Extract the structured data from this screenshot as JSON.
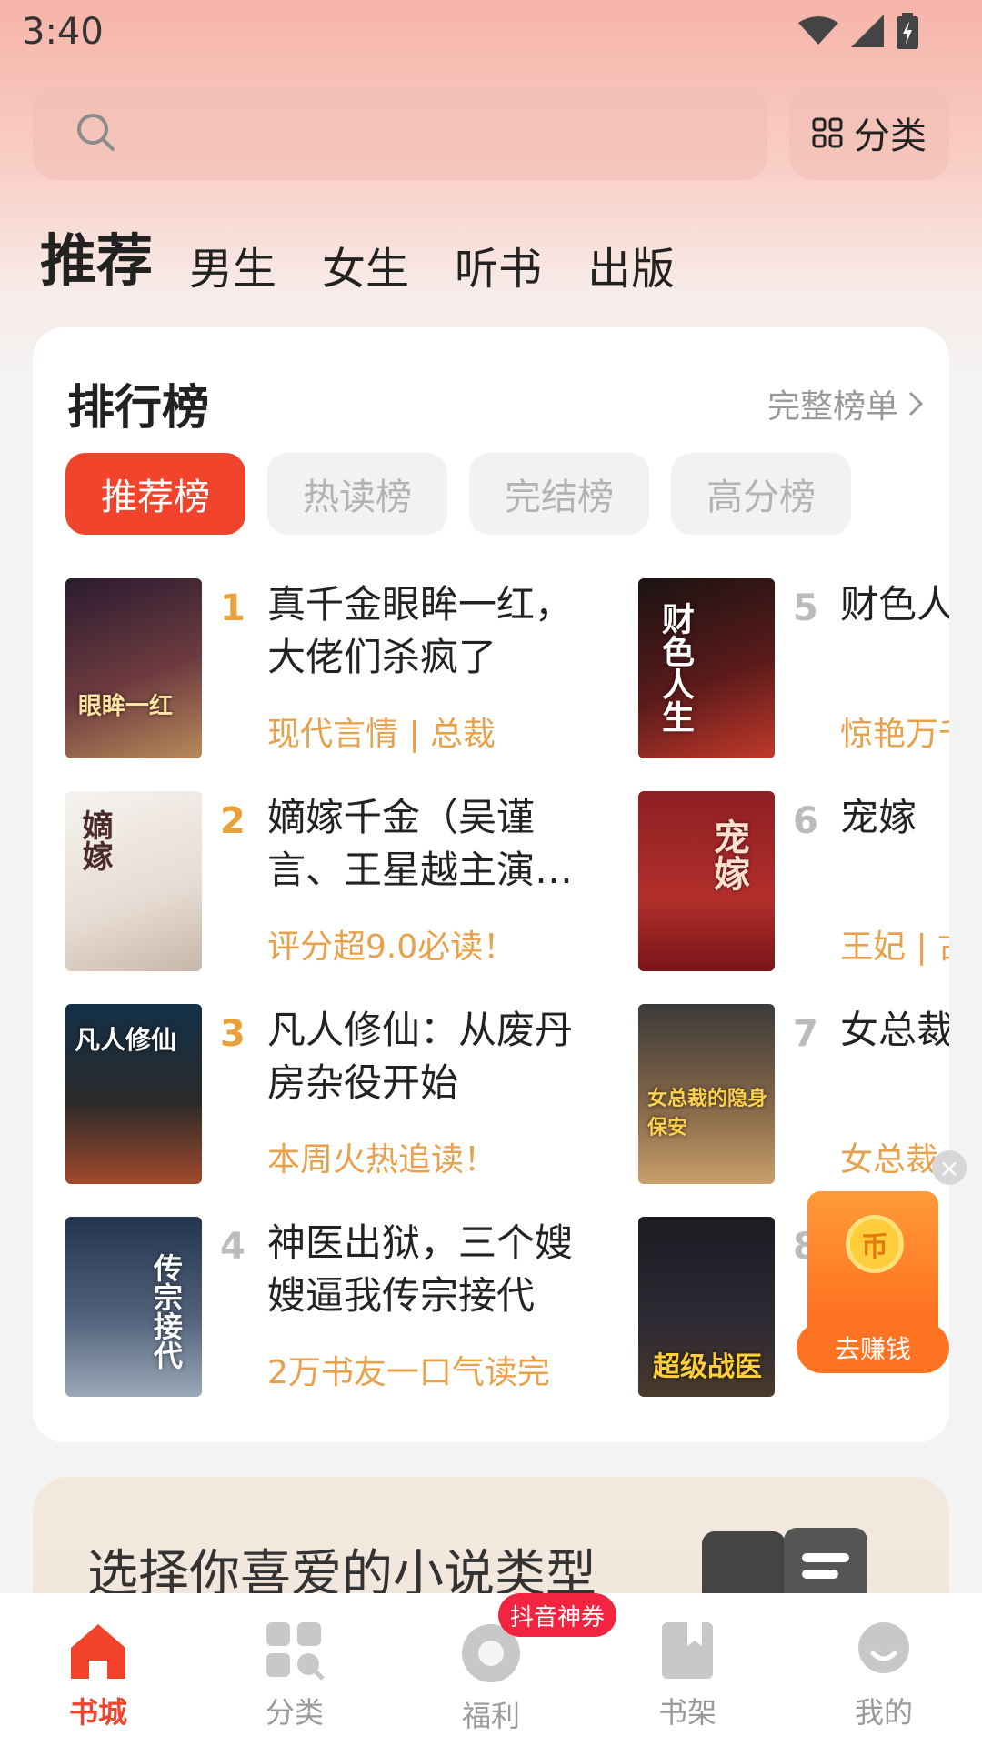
{
  "status_bar": {
    "time": "3:40"
  },
  "search": {
    "category_label": "分类"
  },
  "top_tabs": [
    "推荐",
    "男生",
    "女生",
    "听书",
    "出版"
  ],
  "ranking": {
    "title": "排行榜",
    "full_list_label": "完整榜单",
    "chips": [
      "推荐榜",
      "热读榜",
      "完结榜",
      "高分榜"
    ],
    "books": [
      {
        "rank": "1",
        "title": "真千金眼眸一红，大佬们杀疯了",
        "tag": "现代言情 | 总裁"
      },
      {
        "rank": "2",
        "title": "嫡嫁千金（吴谨言、王星越主演…",
        "tag": "评分超9.0必读！"
      },
      {
        "rank": "3",
        "title": "凡人修仙：从废丹房杂役开始",
        "tag": "本周火热追读！"
      },
      {
        "rank": "4",
        "title": "神医出狱，三个嫂嫂逼我传宗接代",
        "tag": "2万书友一口气读完"
      },
      {
        "rank": "5",
        "title": "财色人",
        "tag": "惊艳万千"
      },
      {
        "rank": "6",
        "title": "宠嫁",
        "tag": "王妃 | 古"
      },
      {
        "rank": "7",
        "title": "女总裁",
        "tag": "女总裁"
      },
      {
        "rank": "8",
        "title": "",
        "tag": ""
      }
    ]
  },
  "banner": {
    "text": "选择你喜爱的小说类型"
  },
  "reward": {
    "coin": "币",
    "button": "去赚钱",
    "close": "×"
  },
  "nav": {
    "items": [
      "书城",
      "分类",
      "福利",
      "书架",
      "我的"
    ],
    "badge": "抖音神券"
  },
  "colors": {
    "accent": "#f2432c",
    "tag": "#e8a14a",
    "rank_top": "#e9a23b"
  }
}
